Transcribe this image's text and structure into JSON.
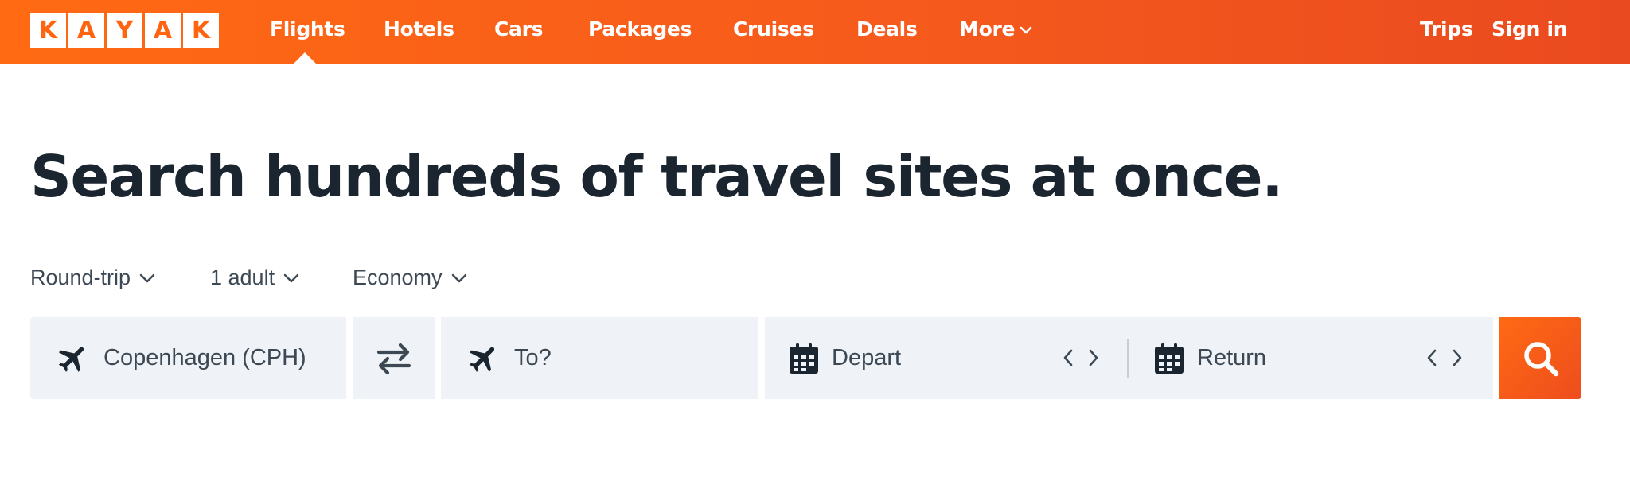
{
  "header": {
    "logo_letters": [
      "K",
      "A",
      "Y",
      "A",
      "K"
    ],
    "nav": {
      "flights": "Flights",
      "hotels": "Hotels",
      "cars": "Cars",
      "packages": "Packages",
      "cruises": "Cruises",
      "deals": "Deals",
      "more": "More"
    },
    "active_tab": "Flights",
    "trips": "Trips",
    "sign_in": "Sign in",
    "brand_color": "#ff6a13"
  },
  "headline": "Search hundreds of travel sites at once.",
  "trip_options": {
    "trip_type": "Round-trip",
    "travelers": "1 adult",
    "cabin": "Economy"
  },
  "search": {
    "origin": "Copenhagen (CPH)",
    "destination_placeholder": "To?",
    "depart_placeholder": "Depart",
    "return_placeholder": "Return",
    "icons": {
      "origin": "plane-icon",
      "swap": "swap-arrows-icon",
      "destination": "plane-icon",
      "depart": "calendar-icon",
      "return": "calendar-icon",
      "submit": "search-icon"
    }
  }
}
